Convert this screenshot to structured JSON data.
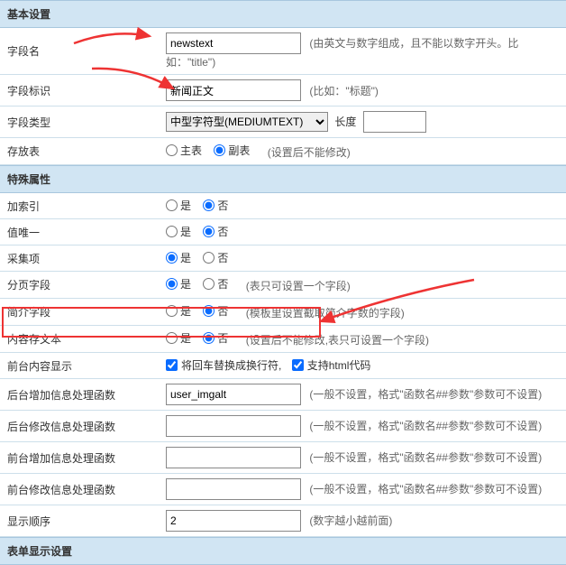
{
  "sections": {
    "basic": "基本设置",
    "special": "特殊属性",
    "formdisp": "表单显示设置"
  },
  "labels": {
    "field_name": "字段名",
    "field_caption": "字段标识",
    "field_type": "字段类型",
    "storage_table": "存放表",
    "add_index": "加索引",
    "unique": "值唯一",
    "collect": "采集项",
    "paging": "分页字段",
    "intro": "简介字段",
    "savetxt": "内容存文本",
    "front_display": "前台内容显示",
    "backend_add_fn": "后台增加信息处理函数",
    "backend_edit_fn": "后台修改信息处理函数",
    "front_add_fn": "前台增加信息处理函数",
    "front_edit_fn": "前台修改信息处理函数",
    "disp_order": "显示顺序",
    "length": "长度"
  },
  "values": {
    "field_name": "newstext",
    "field_caption": "新闻正文",
    "field_type": "中型字符型(MEDIUMTEXT)",
    "length": "",
    "backend_add_fn": "user_imgalt",
    "backend_edit_fn": "",
    "front_add_fn": "",
    "front_edit_fn": "",
    "disp_order": "2"
  },
  "radios": {
    "yes": "是",
    "no": "否",
    "main_table": "主表",
    "sub_table": "副表"
  },
  "checks": {
    "br": "将回车替换成换行符,",
    "html": "支持html代码"
  },
  "hints": {
    "field_name": "(由英文与数字组成，且不能以数字开头。比如：\"title\")",
    "field_caption": "(比如：\"标题\")",
    "storage_table": "(设置后不能修改)",
    "paging": "(表只可设置一个字段)",
    "intro": "(模板里设置截取简介字数的字段)",
    "savetxt": "(设置后不能修改,表只可设置一个字段)",
    "fn": "(一般不设置，格式\"函数名##参数\"参数可不设置)",
    "disp_order": "(数字越小越前面)"
  }
}
